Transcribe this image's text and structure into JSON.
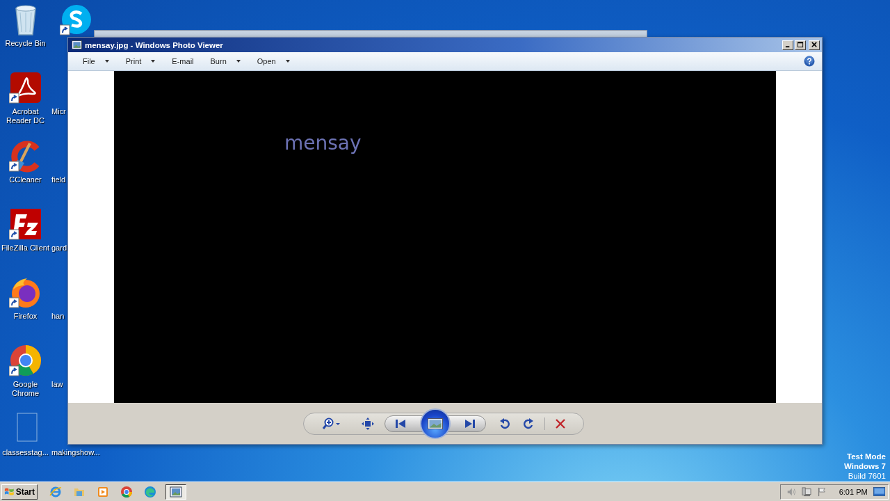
{
  "desktop": {
    "icons": [
      {
        "label": "Recycle Bin",
        "kind": "recycle",
        "shortcut": false
      },
      {
        "label": "Acrobat Reader DC",
        "kind": "acrobat",
        "shortcut": true
      },
      {
        "label": "CCleaner",
        "kind": "ccleaner",
        "shortcut": true
      },
      {
        "label": "FileZilla Client",
        "kind": "filezilla",
        "shortcut": true
      },
      {
        "label": "Firefox",
        "kind": "firefox",
        "shortcut": true
      },
      {
        "label": "Google Chrome",
        "kind": "chrome",
        "shortcut": true
      },
      {
        "label": "classesstag...",
        "kind": "blank",
        "shortcut": false
      },
      {
        "kind": "skype",
        "shortcut": true
      },
      {
        "label": "Micr"
      },
      {
        "label": "field"
      },
      {
        "label": "gard"
      },
      {
        "label": "han"
      },
      {
        "label": "law"
      },
      {
        "label": "makingshow..."
      }
    ]
  },
  "window": {
    "title": "mensay.jpg - Windows Photo Viewer",
    "menu": [
      {
        "label": "File",
        "dropdown": true
      },
      {
        "label": "Print",
        "dropdown": true
      },
      {
        "label": "E-mail",
        "dropdown": false
      },
      {
        "label": "Burn",
        "dropdown": true
      },
      {
        "label": "Open",
        "dropdown": true
      }
    ],
    "image_text": "mensay"
  },
  "watermark": [
    "Test Mode",
    "Windows 7",
    "Build 7601"
  ],
  "taskbar": {
    "start": "Start",
    "apps": [
      {
        "kind": "ie",
        "selected": false
      },
      {
        "kind": "explorer",
        "selected": false
      },
      {
        "kind": "media",
        "selected": false
      },
      {
        "kind": "chrome",
        "selected": false
      },
      {
        "kind": "edge",
        "selected": false
      },
      {
        "kind": "photos",
        "selected": true
      }
    ],
    "clock": "6:01 PM"
  }
}
